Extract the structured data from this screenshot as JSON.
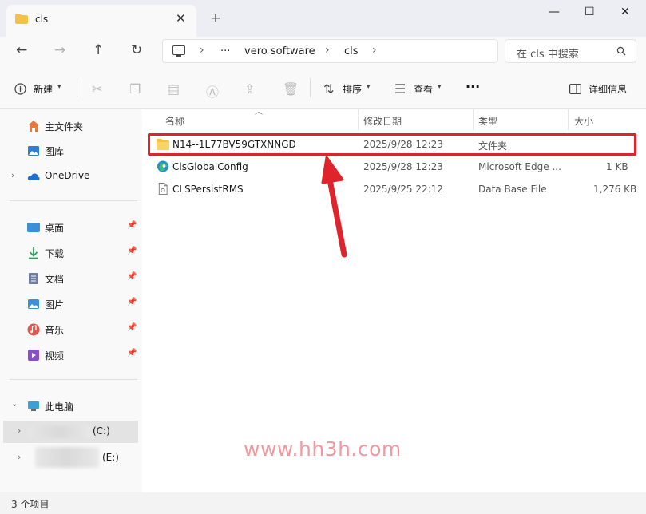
{
  "window": {
    "tab_title": "cls",
    "tab_close": "✕",
    "new_tab": "+",
    "minimize": "—",
    "maximize": "☐",
    "close": "✕"
  },
  "nav": {
    "back": "←",
    "forward": "→",
    "up": "↑",
    "refresh": "↻",
    "more": "···",
    "sep": "›",
    "breadcrumb": [
      "vero software",
      "cls"
    ],
    "search_placeholder": "在 cls 中搜索"
  },
  "toolbar": {
    "new_label": "新建",
    "sort_label": "排序",
    "view_label": "查看",
    "more": "···",
    "details_label": "详细信息"
  },
  "sidebar": {
    "pinned_glyph": "📌",
    "top": [
      {
        "label": "主文件夹",
        "icon": "home-icon",
        "color": "#e8793a"
      },
      {
        "label": "图库",
        "icon": "gallery-icon",
        "color": "#2a7fd4"
      },
      {
        "label": "OneDrive",
        "icon": "onedrive-icon",
        "color": "#1f6fd0"
      }
    ],
    "quick": [
      {
        "label": "桌面",
        "icon": "desktop-icon",
        "color": "#3a8fd9"
      },
      {
        "label": "下载",
        "icon": "download-icon",
        "color": "#2aa05a"
      },
      {
        "label": "文档",
        "icon": "documents-icon",
        "color": "#6e7ea0"
      },
      {
        "label": "图片",
        "icon": "pictures-icon",
        "color": "#3a8fd9"
      },
      {
        "label": "音乐",
        "icon": "music-icon",
        "color": "#e0574f"
      },
      {
        "label": "视频",
        "icon": "videos-icon",
        "color": "#8a4fc8"
      }
    ],
    "pc": {
      "label": "此电脑",
      "icon": "this-pc-icon"
    },
    "drive_c": "(C:)",
    "drive_e": "(E:)"
  },
  "columns": {
    "name": "名称",
    "modified": "修改日期",
    "type": "类型",
    "size": "大小"
  },
  "files": [
    {
      "name": "N14--1L77BV59GTXNNGD",
      "modified": "2025/9/28 12:23",
      "type": "文件夹",
      "size": "",
      "icon": "folder-icon"
    },
    {
      "name": "ClsGlobalConfig",
      "modified": "2025/9/28 12:23",
      "type": "Microsoft Edge ...",
      "size": "1 KB",
      "icon": "edge-icon"
    },
    {
      "name": "CLSPersistRMS",
      "modified": "2025/9/25 22:12",
      "type": "Data Base File",
      "size": "1,276 KB",
      "icon": "file-icon"
    }
  ],
  "watermark": "www.hh3h.com",
  "status": "3 个项目",
  "colors": {
    "highlight": "#e0242c",
    "arrow": "#e0242c",
    "folder": "#f5c342"
  }
}
